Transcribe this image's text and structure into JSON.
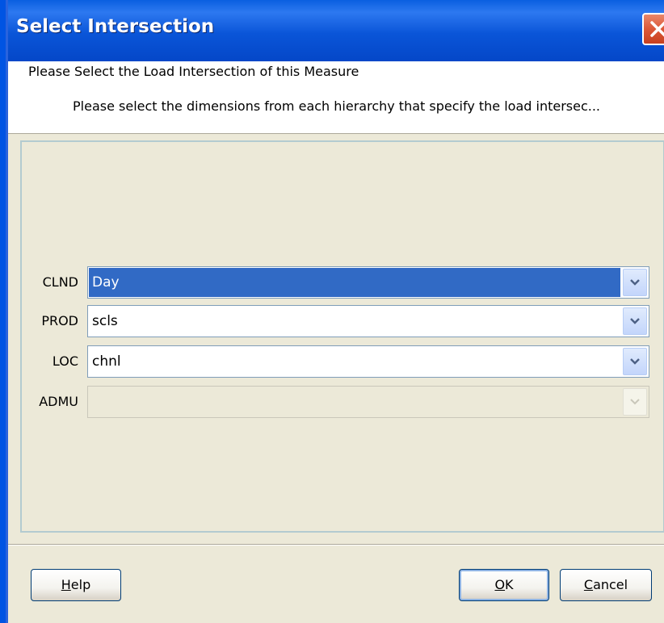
{
  "window": {
    "title": "Select Intersection"
  },
  "header": {
    "title": "Please Select the Load Intersection of this Measure",
    "description": "Please select the dimensions from each hierarchy that specify the load intersec..."
  },
  "form": {
    "rows": [
      {
        "label": "CLND",
        "value": "Day",
        "selected": true,
        "enabled": true
      },
      {
        "label": "PROD",
        "value": "scls",
        "selected": false,
        "enabled": true
      },
      {
        "label": "LOC",
        "value": "chnl",
        "selected": false,
        "enabled": true
      },
      {
        "label": "ADMU",
        "value": "",
        "selected": false,
        "enabled": false
      }
    ]
  },
  "buttons": {
    "help": {
      "mnemonic": "H",
      "rest": "elp"
    },
    "ok": {
      "mnemonic": "O",
      "rest": "K"
    },
    "cancel": {
      "mnemonic": "C",
      "rest": "ancel"
    }
  },
  "colors": {
    "titlebar": "#0a55d8",
    "selection": "#316ac5",
    "dialog_bg": "#ece9d8",
    "close_button": "#dc5838"
  },
  "icons": {
    "close": "close-icon",
    "dropdown": "chevron-down-icon"
  }
}
